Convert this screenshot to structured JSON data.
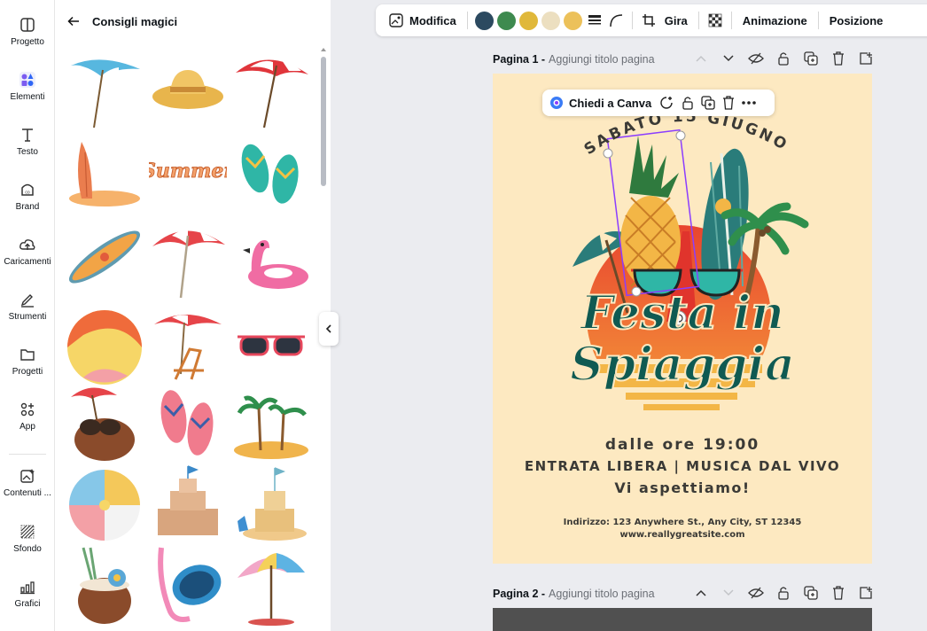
{
  "rail": {
    "items": [
      {
        "label": "Progetto",
        "icon": "layout-icon"
      },
      {
        "label": "Elementi",
        "icon": "elements-icon"
      },
      {
        "label": "Testo",
        "icon": "text-icon"
      },
      {
        "label": "Brand",
        "icon": "brand-icon"
      },
      {
        "label": "Caricamenti",
        "icon": "cloud-upload-icon"
      },
      {
        "label": "Strumenti",
        "icon": "pen-tool-icon"
      },
      {
        "label": "Progetti",
        "icon": "folder-icon"
      },
      {
        "label": "App",
        "icon": "apps-icon"
      },
      {
        "label": "Contenuti ...",
        "icon": "magic-media-icon"
      },
      {
        "label": "Sfondo",
        "icon": "background-icon"
      },
      {
        "label": "Grafici",
        "icon": "charts-icon"
      }
    ],
    "active_index": 1
  },
  "panel": {
    "title": "Consigli magici"
  },
  "toolbar": {
    "modifica": "Modifica",
    "swatches": [
      "#2c4a60",
      "#3e8a4f",
      "#e0b83a",
      "#ecdfc0",
      "#ecc15a"
    ],
    "gira": "Gira",
    "animazione": "Animazione",
    "posizione": "Posizione"
  },
  "page1": {
    "label": "Pagina 1 -",
    "placeholder": "Aggiungi titolo pagina"
  },
  "page2": {
    "label": "Pagina 2 -",
    "placeholder": "Aggiungi titolo pagina"
  },
  "context_menu": {
    "ask": "Chiedi a Canva"
  },
  "design": {
    "arc_text": "SABATO 15 GIUGNO",
    "title_line1": "Festa in",
    "title_line2": "Spiaggia",
    "line1": "dalle ore 19:00",
    "line2": "ENTRATA LIBERA |  MUSICA DAL VIVO",
    "line3": "Vi aspettiamo!",
    "address": "Indirizzo: 123 Anywhere St., Any City, ST 12345",
    "website": "www.reallygreatsite.com"
  }
}
